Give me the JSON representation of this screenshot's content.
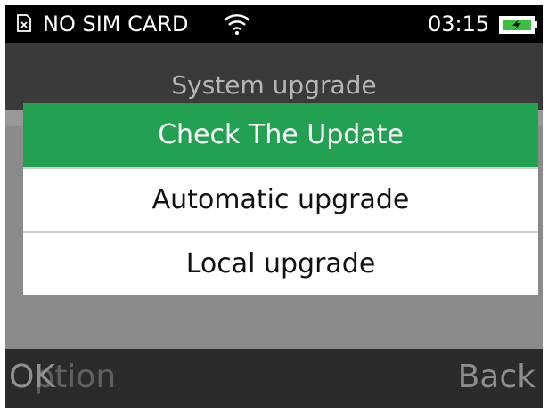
{
  "status_bar": {
    "sim_text": "NO SIM CARD",
    "time": "03:15",
    "icons": [
      "no-sim-icon",
      "wifi-icon",
      "battery-charging-icon"
    ]
  },
  "header": {
    "title": "System upgrade"
  },
  "menu": {
    "items": [
      {
        "label": "Check The Update",
        "selected": true
      },
      {
        "label": "Automatic upgrade",
        "selected": false
      },
      {
        "label": "Local upgrade",
        "selected": false
      }
    ]
  },
  "softkeys": {
    "left_label": "OK",
    "left_ghost_label": "Option",
    "right_label": "Back"
  },
  "colors": {
    "selected_item": "#23a152",
    "status_bar": "#000000",
    "softkey_bar": "#2b2b2b"
  }
}
